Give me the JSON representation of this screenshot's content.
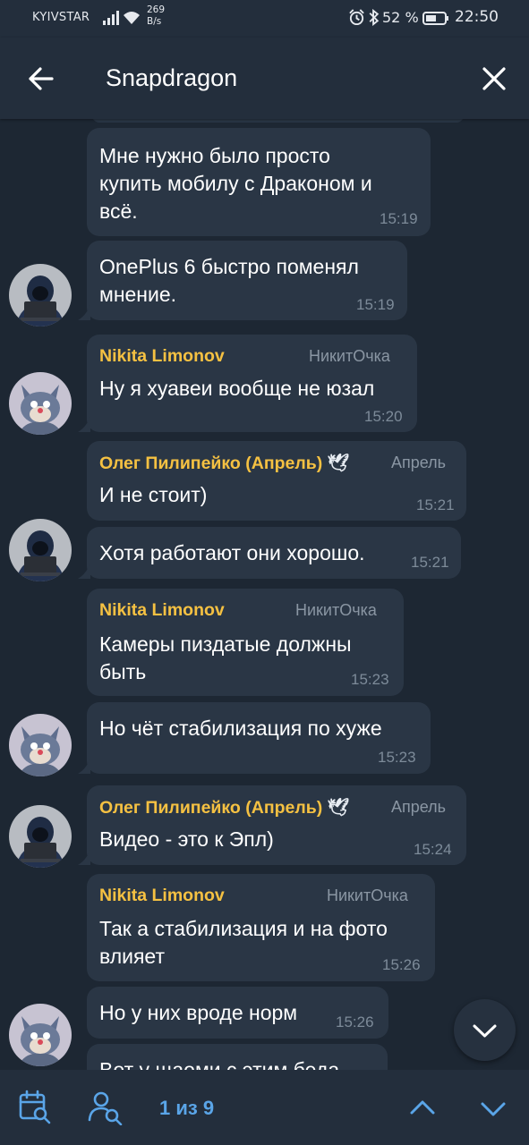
{
  "status_bar": {
    "carrier": "KYIVSTAR",
    "speed_value": "269",
    "speed_unit": "B/s",
    "battery_percent": "52 %",
    "time": "22:50"
  },
  "header": {
    "title": "Snapdragon",
    "back_icon": "arrow-left-icon",
    "close_icon": "close-icon"
  },
  "messages": [
    {
      "lines": [
        "Мне нужно было просто",
        "купить мобилу с Драконом и",
        "всё."
      ],
      "time": "15:19"
    },
    {
      "lines": [
        "OnePlus 6 быстро поменял",
        "мнение."
      ],
      "time": "15:19"
    },
    {
      "sender": "Nikita Limonov",
      "role": "НикитОчка",
      "lines": [
        "Ну я хуавеи вообще не юзал"
      ],
      "time": "15:20"
    },
    {
      "sender": "Олег Пилипейко (Апрель)",
      "sender_emoji": "🕊",
      "role": "Апрель",
      "lines": [
        "И не стоит)"
      ],
      "time": "15:21"
    },
    {
      "lines": [
        "Хотя работают они хорошо."
      ],
      "time": "15:21"
    },
    {
      "sender": "Nikita Limonov",
      "role": "НикитОчка",
      "lines": [
        "Камеры пиздатые должны",
        "быть"
      ],
      "time": "15:23"
    },
    {
      "lines": [
        "Но чёт стабилизация по хуже"
      ],
      "time": "15:23"
    },
    {
      "sender": "Олег Пилипейко (Апрель)",
      "sender_emoji": "🕊",
      "role": "Апрель",
      "lines": [
        "Видео - это к Эпл)"
      ],
      "time": "15:24"
    },
    {
      "sender": "Nikita Limonov",
      "role": "НикитОчка",
      "lines": [
        "Так а стабилизация и на фото",
        "влияет"
      ],
      "time": "15:26"
    },
    {
      "lines": [
        "Но у них вроде норм"
      ],
      "time": "15:26"
    },
    {
      "lines": [
        "Вот у щаоми с этим беда"
      ]
    }
  ],
  "search_nav": {
    "counter": "1 из 9",
    "calendar_icon": "calendar-search-icon",
    "user_icon": "user-search-icon",
    "up_icon": "chevron-up-icon",
    "down_icon": "chevron-down-icon"
  },
  "colors": {
    "background": "#1d2733",
    "bar": "#232e3c",
    "bubble": "#2a3645",
    "sender_name": "#f5c142",
    "accent": "#5aa5e8"
  }
}
